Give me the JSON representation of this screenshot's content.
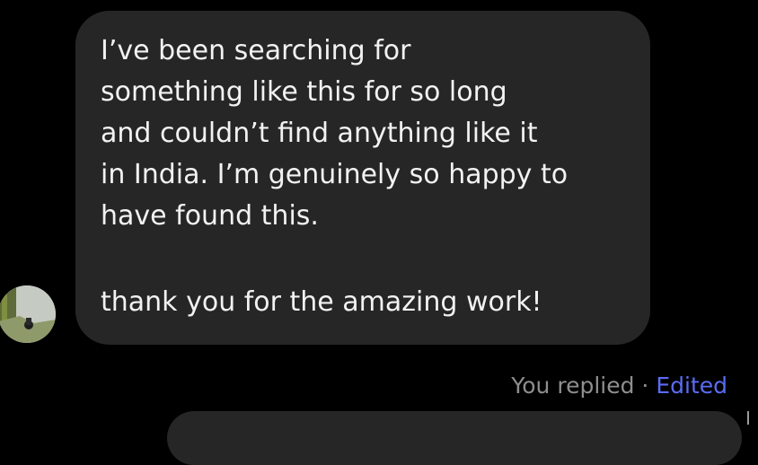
{
  "message": {
    "lines": [
      "I’ve been searching for",
      "something like this for so long",
      "and couldn’t find anything like it",
      "in India. I’m genuinely so happy to",
      "have found this."
    ],
    "closing": "thank you for the amazing work!"
  },
  "meta": {
    "replied": "You replied",
    "separator": "·",
    "edited": "Edited"
  },
  "colors": {
    "background": "#000000",
    "bubble": "#262626",
    "text": "#f2f2f2",
    "meta_text": "#8e8e8e",
    "edited_link": "#5b6cf4"
  }
}
